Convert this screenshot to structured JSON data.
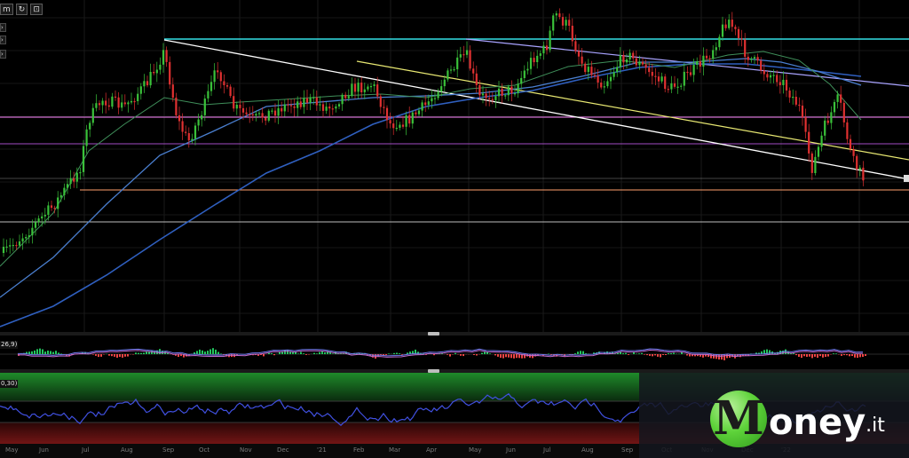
{
  "toolbar": {
    "timeframe_label": "m",
    "refresh_icon": "refresh-icon",
    "screen_icon": "screen-icon"
  },
  "main_chart": {
    "type": "candlestick",
    "colors": {
      "up": "#3ac23a",
      "down": "#e03131",
      "ma_fast": "#3f8f5a",
      "ma_mid": "#4a7fd0",
      "ma_slow": "#2f5fbf",
      "resistance_h": "#33e0e6",
      "fib_pink": "#ff86ff",
      "fib_purple": "#a24dc4",
      "support_orange": "#ff9f6b",
      "level_grey": "#bdbdbd",
      "trend_white": "#ffffff",
      "trend_yellow": "#e8e872",
      "trend_lavender": "#a9a3ff"
    }
  },
  "macd": {
    "label": "26,9)",
    "colors": {
      "pos": "#22c55e",
      "neg": "#ef4444",
      "line1": "#6f7bf0",
      "line2": "#c06bd0"
    }
  },
  "rsi": {
    "label": "0,30)",
    "colors": {
      "line": "#4050e0",
      "overbought": "#1f8a2a",
      "oversold": "#8a1a1a"
    }
  },
  "x_axis": {
    "labels": [
      "May",
      "Jun",
      "Jul",
      "Aug",
      "Sep",
      "Oct",
      "Nov",
      "Dec",
      "'21",
      "Feb",
      "Mar",
      "Apr",
      "May",
      "Jun",
      "Jul",
      "Aug",
      "Sep",
      "Oct",
      "Nov",
      "Dec",
      "'22"
    ]
  },
  "logo": {
    "letter": "M",
    "text": "oney",
    "tld": ".it"
  }
}
